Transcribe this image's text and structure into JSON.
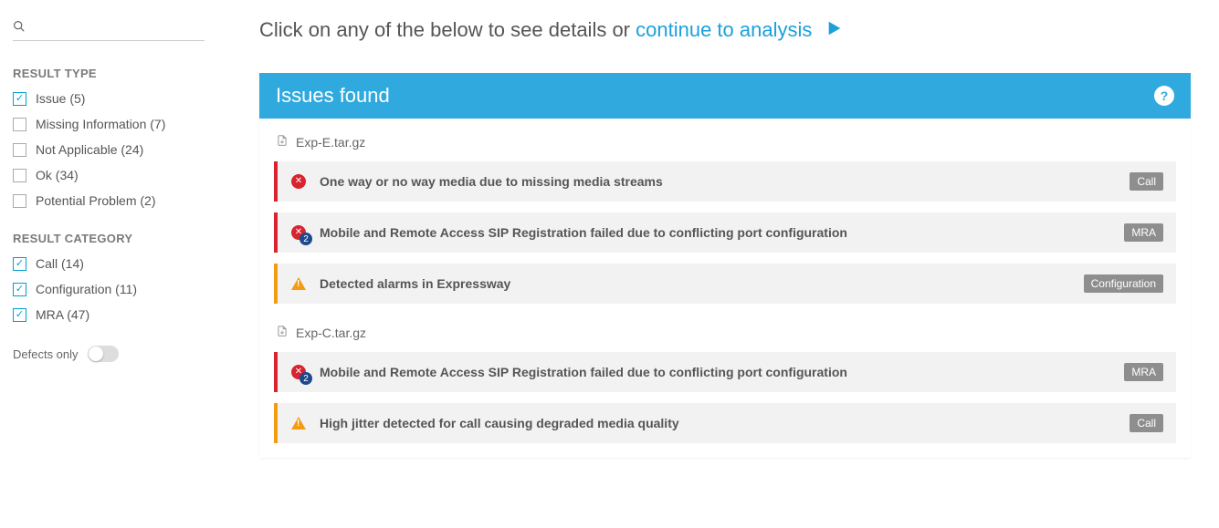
{
  "sidebar": {
    "search": {
      "placeholder": ""
    },
    "result_type": {
      "heading": "RESULT TYPE",
      "items": [
        {
          "label": "Issue (5)",
          "checked": true
        },
        {
          "label": "Missing Information (7)",
          "checked": false
        },
        {
          "label": "Not Applicable (24)",
          "checked": false
        },
        {
          "label": "Ok (34)",
          "checked": false
        },
        {
          "label": "Potential Problem (2)",
          "checked": false
        }
      ]
    },
    "result_category": {
      "heading": "RESULT CATEGORY",
      "items": [
        {
          "label": "Call (14)",
          "checked": true
        },
        {
          "label": "Configuration (11)",
          "checked": true
        },
        {
          "label": "MRA (47)",
          "checked": true
        }
      ]
    },
    "defects_toggle": {
      "label": "Defects only",
      "on": false
    }
  },
  "main": {
    "intro_prefix": "Click on any of the below to see details or ",
    "intro_link": "continue to analysis",
    "issues_header": "Issues found",
    "help_symbol": "?",
    "groups": [
      {
        "file": "Exp-E.tar.gz",
        "issues": [
          {
            "severity": "error",
            "badge": null,
            "title": "One way or no way media due to missing media streams",
            "tag": "Call"
          },
          {
            "severity": "error",
            "badge": "2",
            "title": "Mobile and Remote Access SIP Registration failed due to conflicting port configuration",
            "tag": "MRA"
          },
          {
            "severity": "warn",
            "badge": null,
            "title": "Detected alarms in Expressway",
            "tag": "Configuration"
          }
        ]
      },
      {
        "file": "Exp-C.tar.gz",
        "issues": [
          {
            "severity": "error",
            "badge": "2",
            "title": "Mobile and Remote Access SIP Registration failed due to conflicting port configuration",
            "tag": "MRA"
          },
          {
            "severity": "warn",
            "badge": null,
            "title": "High jitter detected for call causing degraded media quality",
            "tag": "Call"
          }
        ]
      }
    ]
  }
}
